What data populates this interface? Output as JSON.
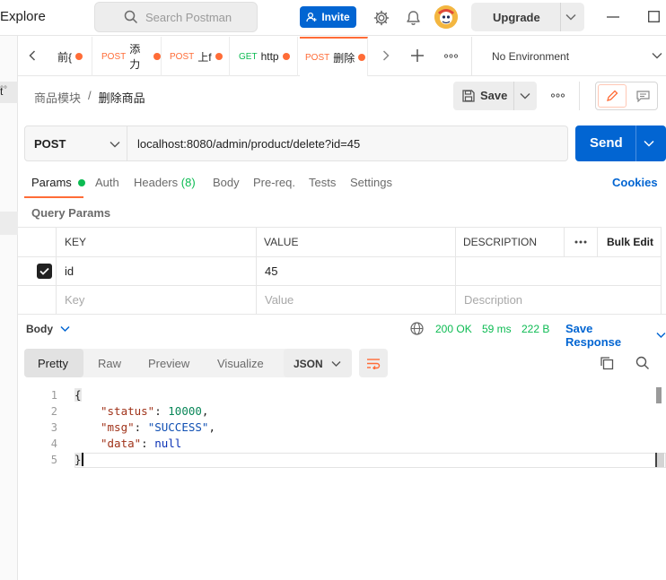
{
  "topbar": {
    "explore_label": "Explore",
    "search_placeholder": "Search Postman",
    "invite_label": "Invite",
    "upgrade_label": "Upgrade"
  },
  "sidebar": {
    "sliver_label": "t",
    "sliver_more": "°°"
  },
  "tabs": [
    {
      "method": "",
      "label": "前{",
      "dirty": true
    },
    {
      "method": "POST",
      "label": "添力",
      "dirty": true
    },
    {
      "method": "POST",
      "label": "上f",
      "dirty": true
    },
    {
      "method": "GET",
      "label": "http",
      "dirty": true
    },
    {
      "method": "POST",
      "label": "删除",
      "dirty": true,
      "active": true
    }
  ],
  "environment": "No Environment",
  "breadcrumb": {
    "parent": "商品模块",
    "separator": "/",
    "current": "删除商品"
  },
  "toolbar": {
    "save_label": "Save"
  },
  "request": {
    "method": "POST",
    "url": "localhost:8080/admin/product/delete?id=45",
    "send_label": "Send"
  },
  "request_tabs": {
    "params": "Params",
    "auth": "Auth",
    "headers": "Headers",
    "headers_count": "(8)",
    "body": "Body",
    "prereq": "Pre-req.",
    "tests": "Tests",
    "settings": "Settings",
    "cookies": "Cookies"
  },
  "query_params": {
    "title": "Query Params",
    "columns": {
      "key": "KEY",
      "value": "VALUE",
      "description": "DESCRIPTION",
      "bulk_edit": "Bulk Edit"
    },
    "rows": [
      {
        "checked": true,
        "key": "id",
        "value": "45",
        "description": ""
      }
    ],
    "placeholder": {
      "key": "Key",
      "value": "Value",
      "description": "Description"
    }
  },
  "response": {
    "body_label": "Body",
    "status": "200 OK",
    "time": "59 ms",
    "size": "222 B",
    "save_response": "Save Response",
    "views": [
      "Pretty",
      "Raw",
      "Preview",
      "Visualize"
    ],
    "active_view": "Pretty",
    "format": "JSON",
    "lines": [
      {
        "num": "1",
        "text": "{"
      },
      {
        "num": "2",
        "key": "\"status\"",
        "value": "10000",
        "suffix": ","
      },
      {
        "num": "3",
        "key": "\"msg\"",
        "value": "\"SUCCESS\"",
        "suffix": ","
      },
      {
        "num": "4",
        "key": "\"data\"",
        "value": "null",
        "suffix": ""
      },
      {
        "num": "5",
        "text": "}"
      }
    ]
  },
  "colors": {
    "accent": "#ff6c37",
    "primary": "#0265d2",
    "success": "#0cbb52",
    "link": "#0265d2"
  }
}
